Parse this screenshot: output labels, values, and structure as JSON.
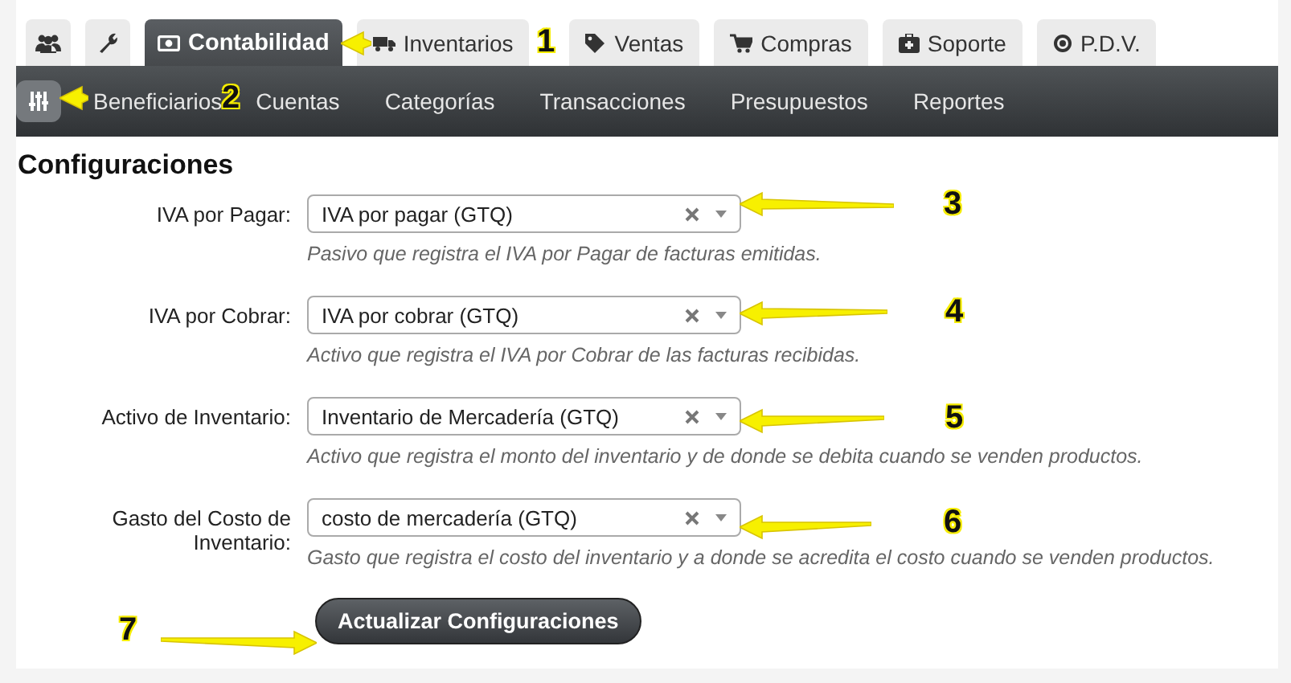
{
  "tabs": [
    {
      "kind": "people",
      "selected": false
    },
    {
      "kind": "wrench",
      "selected": false
    },
    {
      "kind": "money",
      "label": "Contabilidad",
      "selected": true
    },
    {
      "kind": "truck",
      "label": "Inventarios",
      "selected": false
    },
    {
      "kind": "tag",
      "label": "Ventas",
      "selected": false
    },
    {
      "kind": "cart",
      "label": "Compras",
      "selected": false
    },
    {
      "kind": "medkit",
      "label": "Soporte",
      "selected": false
    },
    {
      "kind": "disc",
      "label": "P.D.V.",
      "selected": false
    }
  ],
  "subnav": [
    {
      "kind": "settings",
      "selected": true
    },
    {
      "kind": "link",
      "label": "Beneficiarios",
      "selected": false
    },
    {
      "kind": "link",
      "label": "Cuentas",
      "selected": false
    },
    {
      "kind": "link",
      "label": "Categorías",
      "selected": false
    },
    {
      "kind": "link",
      "label": "Transacciones",
      "selected": false
    },
    {
      "kind": "link",
      "label": "Presupuestos",
      "selected": false
    },
    {
      "kind": "link",
      "label": "Reportes",
      "selected": false
    }
  ],
  "section_title": "Configuraciones",
  "settings": [
    {
      "label": "IVA por Pagar:",
      "value": "IVA por pagar (GTQ)",
      "help": "Pasivo que registra el IVA por Pagar de facturas emitidas."
    },
    {
      "label": "IVA por Cobrar:",
      "value": "IVA por cobrar (GTQ)",
      "help": "Activo que registra el IVA por Cobrar de las facturas recibidas."
    },
    {
      "label": "Activo de Inventario:",
      "value": "Inventario de Mercadería (GTQ)",
      "help": "Activo que registra el monto del inventario y de donde se debita cuando se venden productos."
    },
    {
      "label": "Gasto del Costo de Inventario:",
      "value": "costo de mercadería (GTQ)",
      "help": "Gasto que registra el costo del inventario y a donde se acredita el costo cuando se venden productos."
    }
  ],
  "submit_button": "Actualizar Configuraciones",
  "callouts": [
    {
      "number": "1"
    },
    {
      "number": "2"
    },
    {
      "number": "3"
    },
    {
      "number": "4"
    },
    {
      "number": "5"
    },
    {
      "number": "6"
    },
    {
      "number": "7"
    }
  ]
}
